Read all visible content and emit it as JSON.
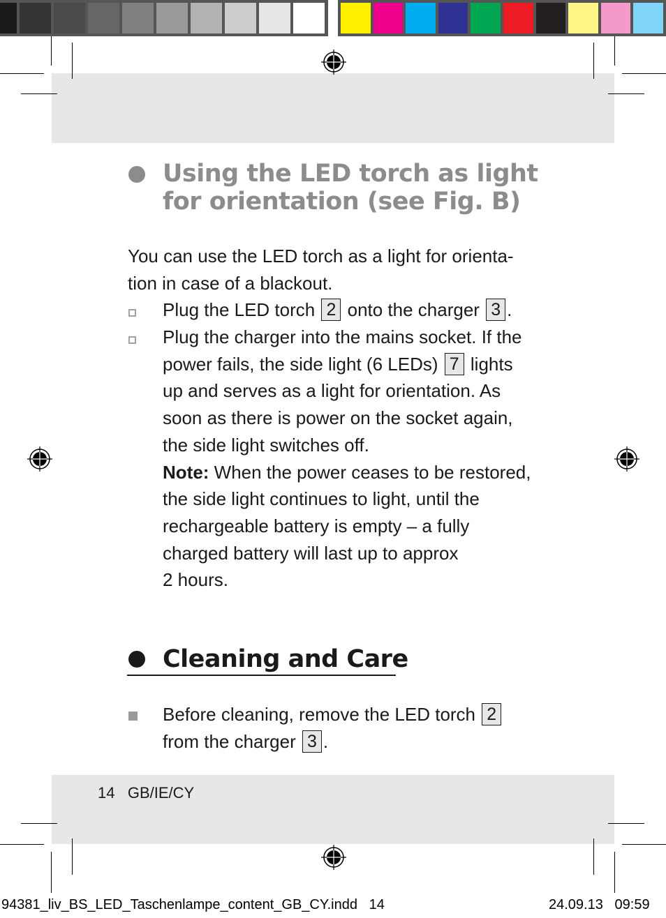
{
  "color_bar": {
    "grayscale": [
      "#1b1b1b",
      "#333333",
      "#4a4a4a",
      "#666666",
      "#808080",
      "#999999",
      "#b3b3b3",
      "#cccccc",
      "#e6e6e6",
      "#ffffff"
    ],
    "colors": [
      "#fff100",
      "#ec008c",
      "#00aeef",
      "#2e3192",
      "#00a651",
      "#ed1c24",
      "#231f20",
      "#fff685",
      "#f49ac9",
      "#7fd4f7"
    ]
  },
  "section1": {
    "heading_line1": "Using the LED torch as light",
    "heading_line2": "for orientation (see Fig. B)",
    "intro_line1": "You can use the LED torch as a light for orienta-",
    "intro_line2": "tion in case of a blackout.",
    "step1": {
      "pre": "Plug the LED torch",
      "ref1": "2",
      "mid": "onto the charger",
      "ref2": "3",
      "post": "."
    },
    "step2": {
      "line1": "Plug the charger into the mains socket. If the",
      "line2_pre": "power fails, the side light (6 LEDs)",
      "line2_ref": "7",
      "line2_post": "lights",
      "line3": "up and serves as a light for orientation. As",
      "line4": "soon as there is power on the socket again,",
      "line5": "the side light switches off."
    },
    "note": {
      "label": "Note:",
      "line1": " When the power ceases to be restored,",
      "line2": "the side light continues to light, until the",
      "line3": "rechargeable battery is empty – a fully",
      "line4": "charged battery will last up to approx",
      "line5": "2 hours."
    }
  },
  "section2": {
    "heading": "Cleaning and Care",
    "item1": {
      "line1_pre": "Before cleaning, remove the LED torch",
      "ref1": "2",
      "line2_pre": "from the charger",
      "ref2": "3",
      "line2_post": "."
    }
  },
  "footer": {
    "page_number": "14",
    "region": "GB/IE/CY"
  },
  "slug": {
    "filename": "94381_liv_BS_LED_Taschenlampe_content_GB_CY.indd",
    "page": "14",
    "date": "24.09.13",
    "time": "09:59"
  }
}
